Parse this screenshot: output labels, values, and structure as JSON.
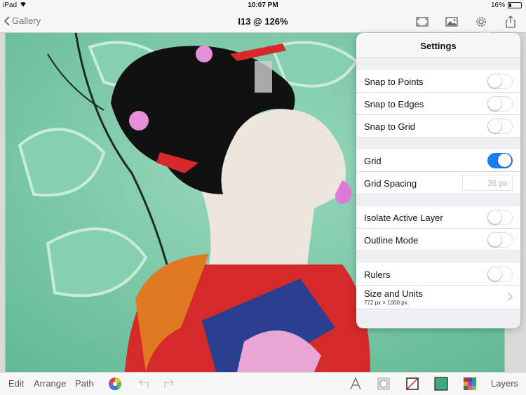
{
  "status": {
    "device": "iPad",
    "time": "10:07 PM",
    "battery": "16%",
    "battery_level": 0.16
  },
  "nav": {
    "back_label": "Gallery",
    "title": "I13 @ 126%"
  },
  "settings": {
    "title": "Settings",
    "snap_points": {
      "label": "Snap to Points",
      "on": false
    },
    "snap_edges": {
      "label": "Snap to Edges",
      "on": false
    },
    "snap_grid": {
      "label": "Snap to Grid",
      "on": false
    },
    "grid": {
      "label": "Grid",
      "on": true
    },
    "grid_spacing": {
      "label": "Grid Spacing",
      "placeholder": "36 px"
    },
    "isolate": {
      "label": "Isolate Active Layer",
      "on": false
    },
    "outline": {
      "label": "Outline Mode",
      "on": false
    },
    "rulers": {
      "label": "Rulers",
      "on": false
    },
    "size_units": {
      "label": "Size and Units",
      "detail": "772 px × 1000 px"
    }
  },
  "toolbar": {
    "edit": "Edit",
    "arrange": "Arrange",
    "path": "Path",
    "layers": "Layers"
  },
  "colors": {
    "accent": "#1a7ef5",
    "fill_swatch": "#3daa80",
    "canvas_bg": "#79c9a6"
  }
}
